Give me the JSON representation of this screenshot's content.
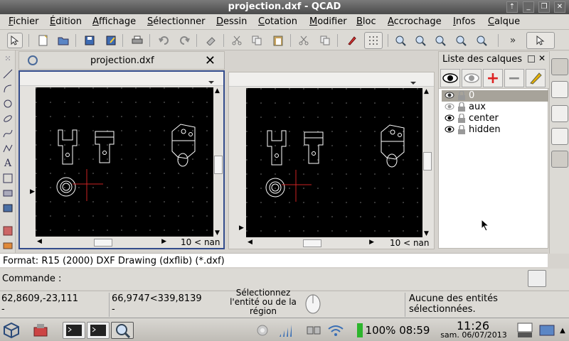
{
  "window": {
    "title": "projection.dxf - QCAD",
    "controls": [
      "⇡",
      "_",
      "❐",
      "✕"
    ]
  },
  "menubar": {
    "items": [
      "Fichier",
      "Édition",
      "Affichage",
      "Sélectionner",
      "Dessin",
      "Cotation",
      "Modifier",
      "Bloc",
      "Accrochage",
      "Infos",
      "Calque"
    ]
  },
  "toolbar": {
    "icons": [
      "pointer-icon",
      "new-file-icon",
      "open-icon",
      "save-icon",
      "save-as-icon",
      "print-icon",
      "undo-icon",
      "redo-icon",
      "eraser-icon",
      "cut-icon",
      "copy-icon",
      "paste-icon",
      "cut2-icon",
      "copy2-icon",
      "pen-icon",
      "grid-icon",
      "zoom-in-icon",
      "zoom-out-icon",
      "zoom-window-icon",
      "zoom-auto-icon",
      "zoom-previous-icon",
      "select-icon"
    ]
  },
  "document": {
    "tab_name": "projection.dxf",
    "close": "✕"
  },
  "views": [
    {
      "coord_label": "10 < nan"
    },
    {
      "coord_label": "10 < nan"
    }
  ],
  "layers_panel": {
    "title": "Liste des calques",
    "layers": [
      {
        "name": "0",
        "visible": true,
        "selected": true
      },
      {
        "name": "aux",
        "visible": false,
        "selected": false
      },
      {
        "name": "center",
        "visible": true,
        "selected": false
      },
      {
        "name": "hidden",
        "visible": true,
        "selected": false
      }
    ]
  },
  "format_line": "Format: R15 (2000) DXF Drawing (dxflib) (*.dxf)",
  "command": {
    "label": "Commande :"
  },
  "status": {
    "abs_coords": "62,8609,-23,111",
    "abs_sub": "-",
    "rel_coords": "66,9747<339,8139",
    "rel_sub": "-",
    "hint_line1": "Sélectionnez",
    "hint_line2": "l'entité ou de la",
    "hint_line3": "région",
    "selection_line1": "Aucune des entités",
    "selection_line2": "sélectionnées."
  },
  "taskbar": {
    "battery": "100% 08:59",
    "time": "11:26",
    "date": "sam. 06/07/2013"
  },
  "colors": {
    "accent": "#334c8c",
    "canvas_bg": "#000000",
    "crosshair": "#cc2222"
  }
}
